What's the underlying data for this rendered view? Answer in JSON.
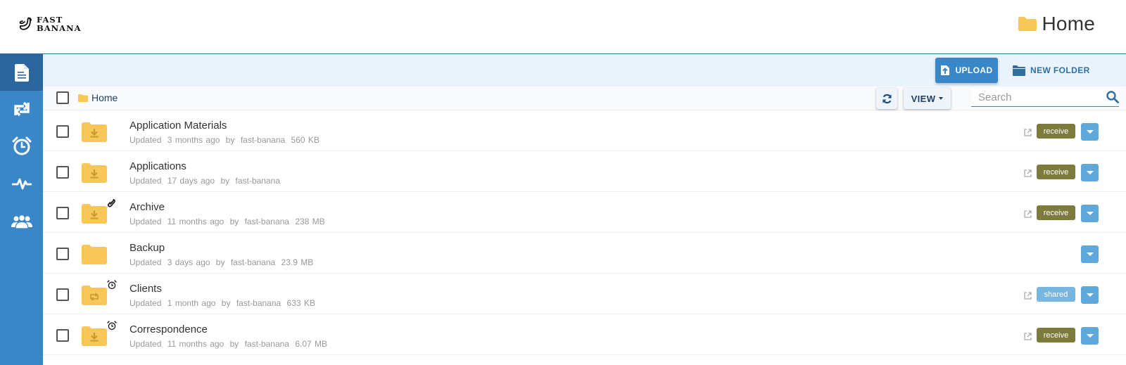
{
  "brand": {
    "line1": "FAST",
    "line2": "BANANA"
  },
  "header": {
    "title": "Home",
    "title_icon": "folder-icon"
  },
  "colors": {
    "sidebar": "#3a87c8",
    "sidebar_active": "#2b679e",
    "accent": "#3a87c8",
    "folder": "#f7c75a",
    "folder_glyph": "#c99a2e",
    "receive_tag": "#7d7a3e",
    "shared_tag": "#77b6e1",
    "dropdown_button": "#5ea8dc"
  },
  "sidebar": {
    "items": [
      {
        "id": "files",
        "icon": "file-icon",
        "active": true
      },
      {
        "id": "sync",
        "icon": "sync-arrows-icon",
        "active": false
      },
      {
        "id": "schedule",
        "icon": "alarm-clock-icon",
        "active": false
      },
      {
        "id": "activity",
        "icon": "activity-pulse-icon",
        "active": false
      },
      {
        "id": "users",
        "icon": "users-icon",
        "active": false
      }
    ]
  },
  "toolbar": {
    "upload_label": "UPLOAD",
    "new_folder_label": "NEW FOLDER",
    "view_label": "VIEW",
    "search_placeholder": "Search",
    "search_value": ""
  },
  "breadcrumb": {
    "items": [
      "Home"
    ]
  },
  "files": [
    {
      "name": "Application Materials",
      "updated_label": "Updated",
      "updated": "3 months ago",
      "by_label": "by",
      "owner": "fast-banana",
      "size": "560 KB",
      "folder_glyph": "download",
      "badge": "",
      "tag": "receive",
      "external_link": true
    },
    {
      "name": "Applications",
      "updated_label": "Updated",
      "updated": "17 days ago",
      "by_label": "by",
      "owner": "fast-banana",
      "size": "",
      "folder_glyph": "download",
      "badge": "",
      "tag": "receive",
      "external_link": true
    },
    {
      "name": "Archive",
      "updated_label": "Updated",
      "updated": "11 months ago",
      "by_label": "by",
      "owner": "fast-banana",
      "size": "238 MB",
      "folder_glyph": "download",
      "badge": "link",
      "tag": "receive",
      "external_link": true
    },
    {
      "name": "Backup",
      "updated_label": "Updated",
      "updated": "3 days ago",
      "by_label": "by",
      "owner": "fast-banana",
      "size": "23.9 MB",
      "folder_glyph": "none",
      "badge": "",
      "tag": "",
      "external_link": false
    },
    {
      "name": "Clients",
      "updated_label": "Updated",
      "updated": "1 month ago",
      "by_label": "by",
      "owner": "fast-banana",
      "size": "633 KB",
      "folder_glyph": "sync",
      "badge": "alarm",
      "tag": "shared",
      "external_link": true
    },
    {
      "name": "Correspondence",
      "updated_label": "Updated",
      "updated": "11 months ago",
      "by_label": "by",
      "owner": "fast-banana",
      "size": "6.07 MB",
      "folder_glyph": "download",
      "badge": "alarm",
      "tag": "receive",
      "external_link": true
    }
  ]
}
